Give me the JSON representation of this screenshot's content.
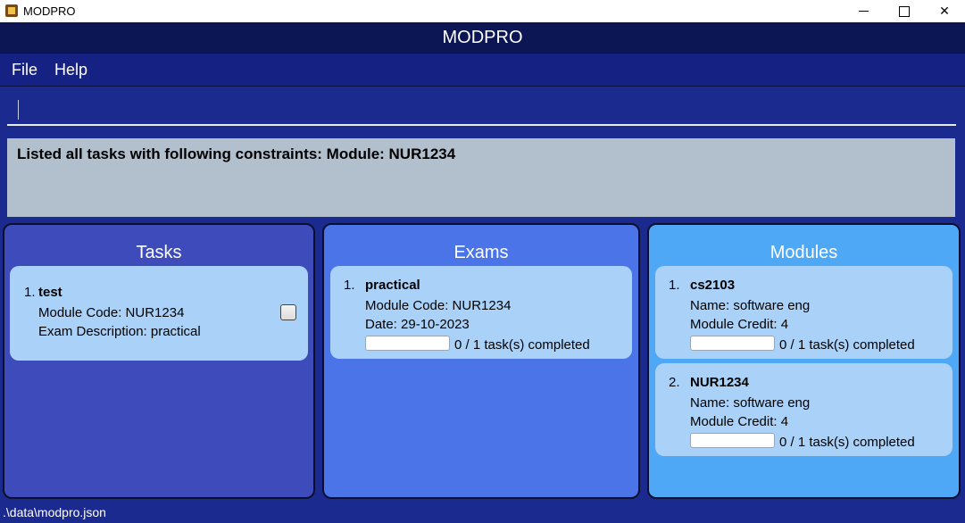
{
  "window": {
    "title": "MODPRO",
    "icon": "java-app-icon"
  },
  "header": {
    "title": "MODPRO"
  },
  "menu": {
    "file_label": "File",
    "help_label": "Help"
  },
  "command": {
    "value": "",
    "placeholder": ""
  },
  "result": {
    "text": "Listed all tasks with following constraints: Module: NUR1234"
  },
  "tasks": {
    "title": "Tasks",
    "items": [
      {
        "index": "1.",
        "name": "test",
        "module_code": "Module Code: NUR1234",
        "exam_description": "Exam Description: practical",
        "checked": false
      }
    ]
  },
  "exams": {
    "title": "Exams",
    "items": [
      {
        "index": "1.",
        "name": "practical",
        "module_code": "Module Code: NUR1234",
        "date": "Date: 29-10-2023",
        "progress_text": "0 / 1 task(s) completed",
        "progress": 0
      }
    ]
  },
  "modules": {
    "title": "Modules",
    "items": [
      {
        "index": "1.",
        "code": "cs2103",
        "name": "Name: software eng",
        "credit": "Module Credit: 4",
        "progress_text": "0 / 1 task(s) completed",
        "progress": 0
      },
      {
        "index": "2.",
        "code": "NUR1234",
        "name": "Name: software eng",
        "credit": "Module Credit: 4",
        "progress_text": "0 / 1 task(s) completed",
        "progress": 0
      }
    ]
  },
  "status": {
    "path": ".\\data\\modpro.json"
  },
  "colors": {
    "app_header": "#0c1654",
    "menu": "#162283",
    "background": "#1b2a8f",
    "result_box": "#b2bfcd",
    "tasks_panel": "#3d4bbb",
    "exams_panel": "#4a74e8",
    "modules_panel": "#4fa8f5",
    "card": "#aad2f8"
  }
}
